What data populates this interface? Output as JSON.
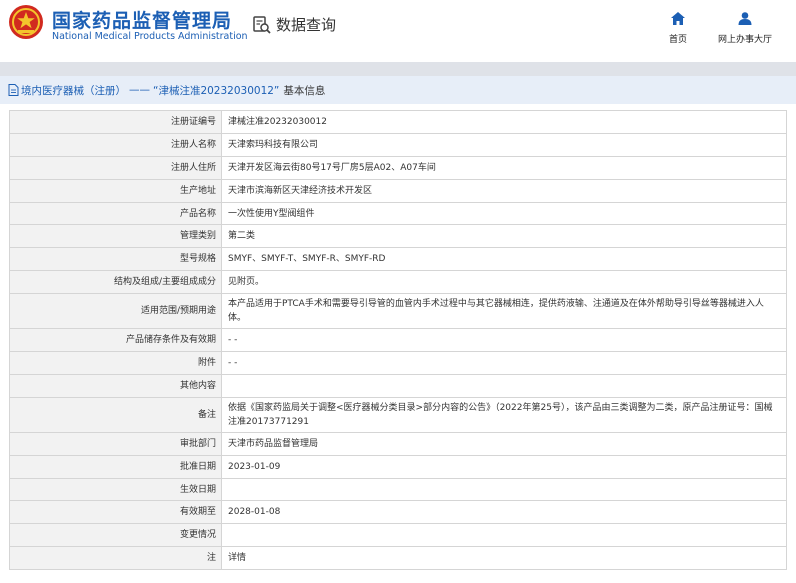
{
  "header": {
    "brand_cn": "国家药品监督管理局",
    "brand_en": "National Medical Products Administration",
    "query_label": "数据查询",
    "nav": [
      {
        "label": "首页",
        "icon": "home-icon"
      },
      {
        "label": "网上办事大厅",
        "icon": "user-icon"
      }
    ]
  },
  "breadcrumb": {
    "category": "境内医疗器械（注册）",
    "separator": "——",
    "record": "“津械注准20232030012”",
    "suffix": "基本信息"
  },
  "colors": {
    "brand_blue": "#1c5fb4",
    "title_bar": "#e7eef8",
    "label_bg": "#f2f2f2"
  },
  "rows": [
    {
      "label": "注册证编号",
      "value": "津械注准20232030012"
    },
    {
      "label": "注册人名称",
      "value": "天津索玛科技有限公司"
    },
    {
      "label": "注册人住所",
      "value": "天津开发区海云街80号17号厂房5层A02、A07车间"
    },
    {
      "label": "生产地址",
      "value": "天津市滨海新区天津经济技术开发区"
    },
    {
      "label": "产品名称",
      "value": "一次性使用Y型阀组件"
    },
    {
      "label": "管理类别",
      "value": "第二类"
    },
    {
      "label": "型号规格",
      "value": "SMYF、SMYF-T、SMYF-R、SMYF-RD"
    },
    {
      "label": "结构及组成/主要组成成分",
      "value": "见附页。"
    },
    {
      "label": "适用范围/预期用途",
      "value": "本产品适用于PTCA手术和需要导引导管的血管内手术过程中与其它器械相连，提供药液输、注通道及在体外帮助导引导丝等器械进入人体。"
    },
    {
      "label": "产品储存条件及有效期",
      "value": "- -"
    },
    {
      "label": "附件",
      "value": "- -"
    },
    {
      "label": "其他内容",
      "value": ""
    },
    {
      "label": "备注",
      "value": "依据《国家药监局关于调整<医疗器械分类目录>部分内容的公告》（2022年第25号），该产品由三类调整为二类，原产品注册证号：国械注准20173771291"
    },
    {
      "label": "审批部门",
      "value": "天津市药品监督管理局"
    },
    {
      "label": "批准日期",
      "value": "2023-01-09"
    },
    {
      "label": "生效日期",
      "value": ""
    },
    {
      "label": "有效期至",
      "value": "2028-01-08"
    },
    {
      "label": "变更情况",
      "value": ""
    },
    {
      "label": "注",
      "value": "详情"
    }
  ]
}
